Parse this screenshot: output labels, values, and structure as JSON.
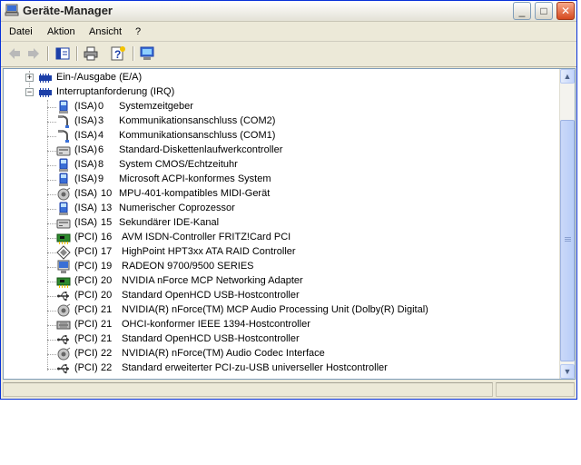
{
  "window": {
    "title": "Geräte-Manager"
  },
  "menu": [
    "Datei",
    "Aktion",
    "Ansicht",
    "?"
  ],
  "tree": {
    "categories": [
      {
        "label": "Ein-/Ausgabe (E/A)",
        "expander": "+"
      },
      {
        "label": "Interruptanforderung (IRQ)",
        "expander": "−"
      }
    ],
    "devices": [
      {
        "bus": "(ISA)",
        "num": "0",
        "name": "Systemzeitgeber",
        "icon": "system-icon"
      },
      {
        "bus": "(ISA)",
        "num": "3",
        "name": "Kommunikationsanschluss (COM2)",
        "icon": "port-icon"
      },
      {
        "bus": "(ISA)",
        "num": "4",
        "name": "Kommunikationsanschluss (COM1)",
        "icon": "port-icon"
      },
      {
        "bus": "(ISA)",
        "num": "6",
        "name": "Standard-Diskettenlaufwerkcontroller",
        "icon": "floppy-controller-icon"
      },
      {
        "bus": "(ISA)",
        "num": "8",
        "name": "System CMOS/Echtzeituhr",
        "icon": "system-icon"
      },
      {
        "bus": "(ISA)",
        "num": "9",
        "name": "Microsoft ACPI-konformes System",
        "icon": "system-icon"
      },
      {
        "bus": "(ISA)",
        "num": "10",
        "name": "MPU-401-kompatibles MIDI-Gerät",
        "icon": "sound-icon"
      },
      {
        "bus": "(ISA)",
        "num": "13",
        "name": "Numerischer Coprozessor",
        "icon": "system-icon"
      },
      {
        "bus": "(ISA)",
        "num": "15",
        "name": "Sekundärer IDE-Kanal",
        "icon": "ide-controller-icon"
      },
      {
        "bus": "(PCI)",
        "num": "16",
        "name": "AVM ISDN-Controller FRITZ!Card PCI",
        "icon": "network-card-icon"
      },
      {
        "bus": "(PCI)",
        "num": "17",
        "name": "HighPoint HPT3xx ATA RAID Controller",
        "icon": "scsi-controller-icon"
      },
      {
        "bus": "(PCI)",
        "num": "19",
        "name": "RADEON 9700/9500 SERIES",
        "icon": "display-icon"
      },
      {
        "bus": "(PCI)",
        "num": "20",
        "name": "NVIDIA nForce MCP Networking Adapter",
        "icon": "network-card-icon"
      },
      {
        "bus": "(PCI)",
        "num": "20",
        "name": "Standard OpenHCD USB-Hostcontroller",
        "icon": "usb-icon"
      },
      {
        "bus": "(PCI)",
        "num": "21",
        "name": "NVIDIA(R) nForce(TM) MCP Audio Processing Unit (Dolby(R) Digital)",
        "icon": "sound-icon"
      },
      {
        "bus": "(PCI)",
        "num": "21",
        "name": "OHCI-konformer IEEE 1394-Hostcontroller",
        "icon": "firewire-icon"
      },
      {
        "bus": "(PCI)",
        "num": "21",
        "name": "Standard OpenHCD USB-Hostcontroller",
        "icon": "usb-icon"
      },
      {
        "bus": "(PCI)",
        "num": "22",
        "name": "NVIDIA(R) nForce(TM) Audio Codec Interface",
        "icon": "sound-icon"
      },
      {
        "bus": "(PCI)",
        "num": "22",
        "name": "Standard erweiterter PCI-zu-USB universeller Hostcontroller",
        "icon": "usb-icon"
      }
    ]
  },
  "colors": {
    "titlebar_border": "#0831d9",
    "tree_background": "#ffffff",
    "chip_blue": "#1c3fa8"
  }
}
